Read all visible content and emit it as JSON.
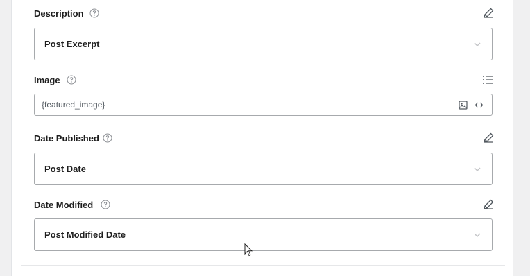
{
  "fields": {
    "description": {
      "label": "Description",
      "value": "Post Excerpt",
      "action_icon": "pencil-icon"
    },
    "image": {
      "label": "Image",
      "value": "{featured_image}",
      "action_icon": "list-icon",
      "input_icons": [
        "image-icon",
        "code-icon"
      ]
    },
    "date_published": {
      "label": "Date Published",
      "value": "Post Date",
      "action_icon": "pencil-icon"
    },
    "date_modified": {
      "label": "Date Modified",
      "value": "Post Modified Date",
      "action_icon": "pencil-icon"
    }
  },
  "colors": {
    "background": "#f0f0f1",
    "panel": "#ffffff",
    "border": "#a7aaad",
    "icon": "#50575e",
    "text": "#1e1e1e"
  }
}
